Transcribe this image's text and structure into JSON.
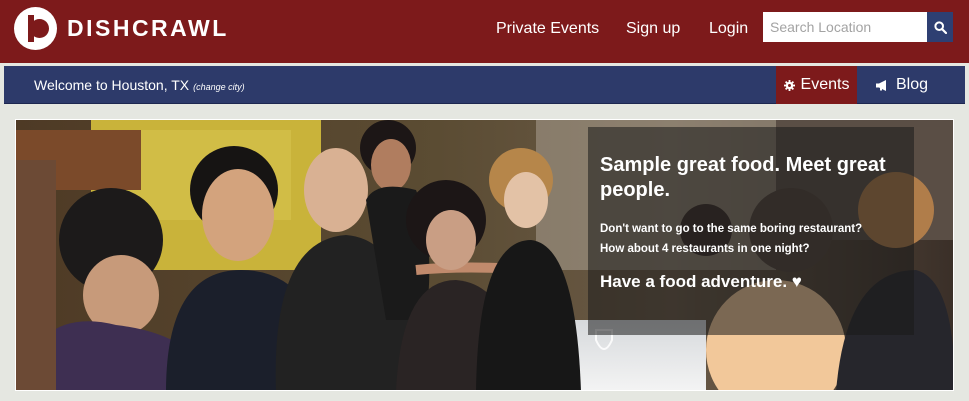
{
  "brand": {
    "name": "DISHCRAWL"
  },
  "topnav": {
    "private_events": "Private Events",
    "sign_up": "Sign up",
    "login": "Login"
  },
  "search": {
    "placeholder": "Search Location"
  },
  "subnav": {
    "welcome": "Welcome to Houston, TX",
    "change_city": "(change city)",
    "events": "Events",
    "blog": "Blog"
  },
  "hero": {
    "title": "Sample great food. Meet great people.",
    "line1": "Don't want to go to the same boring restaurant?",
    "line2": "How about 4 restaurants in one night?",
    "tagline": "Have a food adventure. ♥"
  },
  "colors": {
    "header": "#7d1a1b",
    "subbar": "#2d3a6a",
    "search_button": "#2e3f72",
    "page_bg": "#e5e7e1"
  },
  "icons": [
    "logo-mark-icon",
    "search-icon",
    "gear-icon",
    "megaphone-icon"
  ]
}
